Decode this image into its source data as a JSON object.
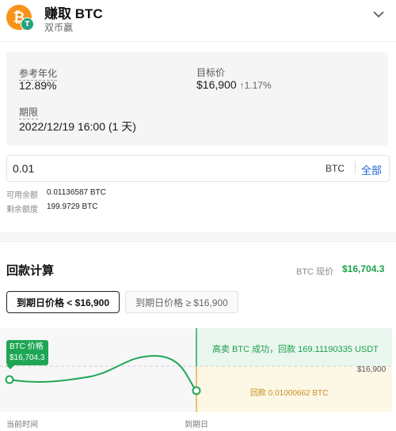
{
  "header": {
    "title": "赚取 BTC",
    "subtitle": "双币赢",
    "coin_glyph": "₿",
    "badge_glyph": "T"
  },
  "info": {
    "apy_label": "参考年化",
    "apy_value": "12.89%",
    "target_label": "目标价",
    "target_value": "$16,900",
    "target_change": "↑1.17%",
    "term_label": "期限",
    "term_value": "2022/12/19 16:00 (1 天)"
  },
  "amount": {
    "value": "0.01",
    "currency": "BTC",
    "all_label": "全部"
  },
  "balances": {
    "available_label": "可用余额",
    "available_value": "0.01136587 BTC",
    "remaining_label": "剩余额度",
    "remaining_value": "199.9729 BTC"
  },
  "repayment": {
    "title": "回款计算",
    "spot_label": "BTC 现价",
    "spot_value": "$16,704.3",
    "tabs": [
      {
        "label": "到期日价格 < $16,900",
        "active": true
      },
      {
        "label": "到期日价格 ≥ $16,900",
        "active": false
      }
    ],
    "chart": {
      "current_price_label": "BTC 价格",
      "current_price_value": "$16,704.3",
      "above_text": "高卖 BTC 成功，回款 169.11190335 USDT",
      "below_text": "回款 0.01000662 BTC",
      "strike_label": "$16,900",
      "x_start_label": "当前时间",
      "x_end_label": "到期日"
    }
  },
  "colors": {
    "accent_blue": "#1f66d6",
    "green": "#16a34a",
    "bitcoin_orange": "#f7931a",
    "yellow_text": "#c58f1b"
  }
}
